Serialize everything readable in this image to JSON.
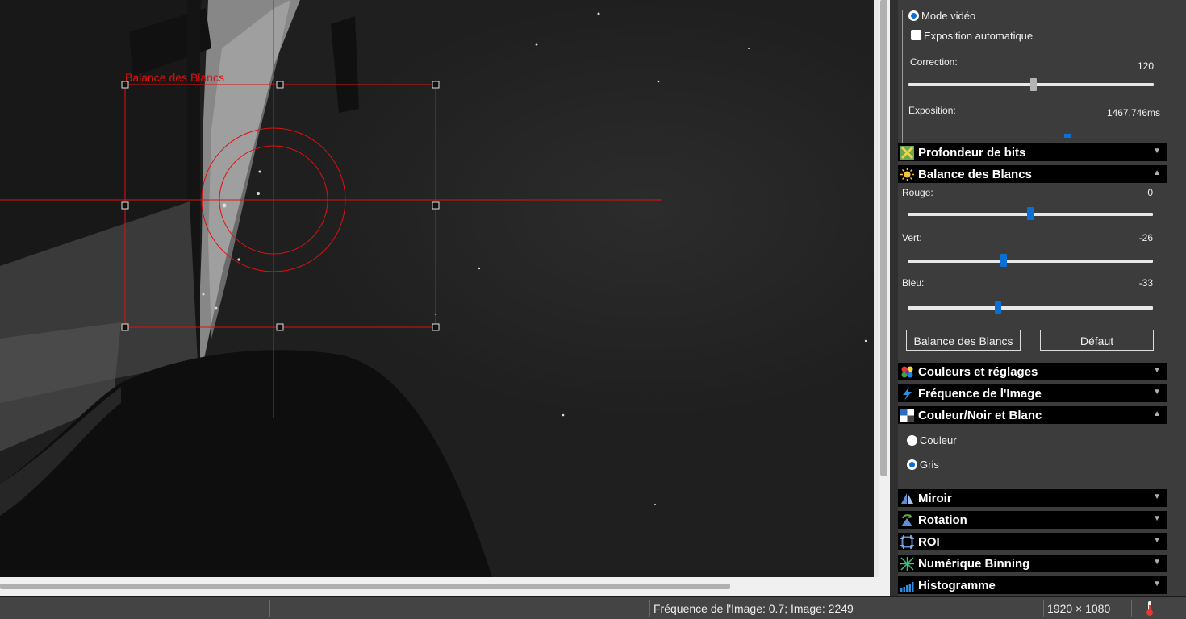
{
  "overlay": {
    "label": "Balance des Blancs",
    "color": "#e01010"
  },
  "panel": {
    "video_mode": {
      "label": "Mode vidéo",
      "selected": true
    },
    "auto_exposure": {
      "label": "Exposition automatique",
      "checked": false
    },
    "correction": {
      "label": "Correction:",
      "value": "120",
      "level": 0.51
    },
    "exposure": {
      "label": "Exposition:",
      "value": "1467.746ms"
    },
    "sections": {
      "bit_depth": {
        "label": "Profondeur de bits",
        "icon": "bit-depth-icon"
      },
      "white_balance": {
        "label": "Balance des Blancs",
        "icon": "sun-icon"
      },
      "colors": {
        "label": "Couleurs et réglages",
        "icon": "color-palette-icon"
      },
      "frame_rate": {
        "label": "Fréquence de l'Image",
        "icon": "lightning-icon"
      },
      "color_bw": {
        "label": "Couleur/Noir et Blanc",
        "icon": "color-bw-icon"
      },
      "mirror": {
        "label": "Miroir",
        "icon": "mirror-icon"
      },
      "rotation": {
        "label": "Rotation",
        "icon": "rotation-icon"
      },
      "roi": {
        "label": "ROI",
        "icon": "roi-icon"
      },
      "binning": {
        "label": "Numérique Binning",
        "icon": "binning-icon"
      },
      "histogram": {
        "label": "Histogramme",
        "icon": "histogram-icon"
      }
    },
    "wb": {
      "red": {
        "label": "Rouge:",
        "value": "0",
        "level": 0.5
      },
      "green": {
        "label": "Vert:",
        "value": "-26",
        "level": 0.39
      },
      "blue": {
        "label": "Bleu:",
        "value": "-33",
        "level": 0.37
      },
      "wb_button": "Balance des Blancs",
      "default_button": "Défaut"
    },
    "color_mode": {
      "color": {
        "label": "Couleur",
        "selected": false
      },
      "gray": {
        "label": "Gris",
        "selected": true
      }
    },
    "accent_color": "#0a6fd6"
  },
  "status": {
    "frame_info": "Fréquence de l'Image: 0.7; Image: 2249",
    "resolution": "1920 × 1080",
    "temp_icon": "thermometer-icon"
  }
}
